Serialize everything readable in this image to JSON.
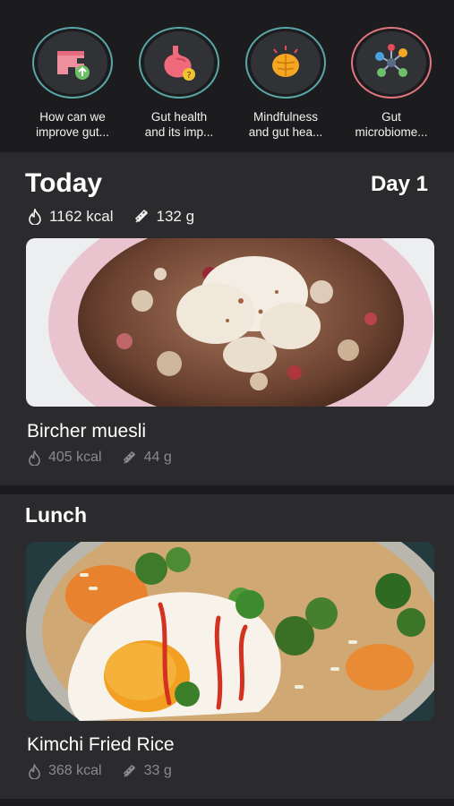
{
  "stories": [
    {
      "label": "How can we\nimprove gut...",
      "icon": "intestine-icon"
    },
    {
      "label": "Gut health\nand its imp...",
      "icon": "stomach-icon"
    },
    {
      "label": "Mindfulness\nand gut hea...",
      "icon": "brain-icon"
    },
    {
      "label": "Gut\nmicrobiome...",
      "icon": "molecule-icon"
    }
  ],
  "today": {
    "title": "Today",
    "day": "Day 1",
    "kcal": "1162 kcal",
    "carbs": "132 g"
  },
  "breakfast": {
    "name": "Bircher muesli",
    "kcal": "405 kcal",
    "carbs": "44 g"
  },
  "lunch": {
    "title": "Lunch",
    "name": "Kimchi Fried Rice",
    "kcal": "368 kcal",
    "carbs": "33 g"
  },
  "colors": {
    "background": "#1c1c1e",
    "card": "#2b2b2e",
    "story_ring": "#5aa7a8",
    "muted_text": "#8a8a8e"
  }
}
